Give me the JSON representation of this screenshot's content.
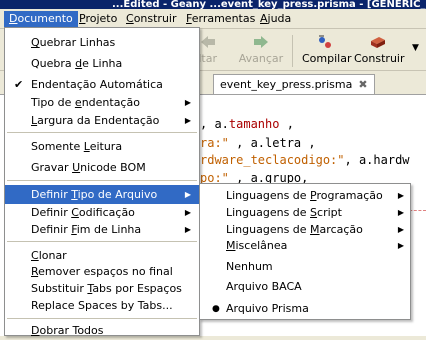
{
  "window": {
    "title": "...Edited - Geany ...event_key_press.prisma - [GENERIC_BOX]"
  },
  "menubar": {
    "items": [
      {
        "label": "Documento",
        "mnemonic": "D",
        "rest": "ocumento"
      },
      {
        "label": "Projeto",
        "mnemonic": "P",
        "rest": "rojeto"
      },
      {
        "label": "Construir",
        "mnemonic": "C",
        "rest": "onstruir"
      },
      {
        "label": "Ferramentas",
        "mnemonic": "F",
        "rest": "erramentas"
      },
      {
        "label": "Ajuda",
        "mnemonic": "A",
        "rest": "juda"
      }
    ]
  },
  "toolbar": {
    "navigate_back": "Voltar",
    "navigate_forward": "Avançar",
    "compile": "Compilar",
    "build": "Construir"
  },
  "tabs": [
    {
      "label": "event_key_press.prisma"
    }
  ],
  "editor": {
    "lines": [
      {
        "pre": ", a.",
        "keyword": "tamanho",
        "post": " ,"
      },
      {
        "str": "ra:\"",
        "post": " , a.letra ,"
      },
      {
        "str": "rdware_teclacodigo:\"",
        "post": ", a.hardw"
      },
      {
        "str": "po:\"",
        "post": " , a.grupo,"
      },
      {
        "post": ","
      }
    ]
  },
  "menu_documento": {
    "items": [
      {
        "label": "Quebrar Linhas",
        "mnemonic": "Q",
        "rest": "uebrar Linhas"
      },
      {
        "label": "Quebra de Linha",
        "pre": "Quebra ",
        "mnemonic": "d",
        "rest": "e Linha"
      },
      {
        "label": "Endentação Automática",
        "checked": true
      },
      {
        "label": "Tipo de endentação",
        "pre": "Tipo de ",
        "mnemonic": "e",
        "rest": "ndentação",
        "submenu": true
      },
      {
        "label": "Largura da Endentação",
        "mnemonic": "L",
        "rest": "argura da Endentação",
        "submenu": true
      },
      {
        "label": "Somente Leitura",
        "pre": "Somente ",
        "mnemonic": "L",
        "rest": "eitura"
      },
      {
        "label": "Gravar Unicode BOM",
        "pre": "Gravar ",
        "mnemonic": "U",
        "rest": "nicode BOM"
      },
      {
        "label": "Definir Tipo de Arquivo",
        "pre": "Definir ",
        "mnemonic": "T",
        "rest": "ipo de Arquivo",
        "submenu": true,
        "highlighted": true
      },
      {
        "label": "Definir Codificação",
        "pre": "Definir ",
        "mnemonic": "C",
        "rest": "odificação",
        "submenu": true
      },
      {
        "label": "Definir Fim de Linha",
        "pre": "Definir ",
        "mnemonic": "F",
        "rest": "im de Linha",
        "submenu": true
      },
      {
        "label": "Clonar",
        "mnemonic": "C",
        "rest": "lonar"
      },
      {
        "label": "Remover espaços no final",
        "mnemonic": "R",
        "rest": "emover espaços no final"
      },
      {
        "label": "Substituir Tabs por Espaços",
        "pre": "Substituir ",
        "mnemonic": "T",
        "rest": "abs por Espaços"
      },
      {
        "label": "Replace Spaces by Tabs..."
      },
      {
        "label": "Dobrar Todos",
        "mnemonic": "D",
        "rest": "obrar Todos"
      }
    ]
  },
  "menu_tipo_arquivo": {
    "items": [
      {
        "label": "Linguagens de Programação",
        "pre": "Linguagens de ",
        "mnemonic": "P",
        "rest": "rogramação",
        "submenu": true
      },
      {
        "label": "Linguagens de Script",
        "pre": "Linguagens de ",
        "mnemonic": "S",
        "rest": "cript",
        "submenu": true
      },
      {
        "label": "Linguagens de Marcação",
        "pre": "Linguagens de ",
        "mnemonic": "M",
        "rest": "arcação",
        "submenu": true
      },
      {
        "label": "Miscelânea",
        "mnemonic": "M",
        "rest": "iscelânea",
        "submenu": true
      },
      {
        "label": "Nenhum"
      },
      {
        "label": "Arquivo BACA"
      },
      {
        "label": "Arquivo Prisma",
        "selected": true
      }
    ]
  },
  "colors": {
    "highlight": "#316ac5",
    "menubar_bg": "#ece9d8",
    "titlebar": "#0a246a"
  }
}
